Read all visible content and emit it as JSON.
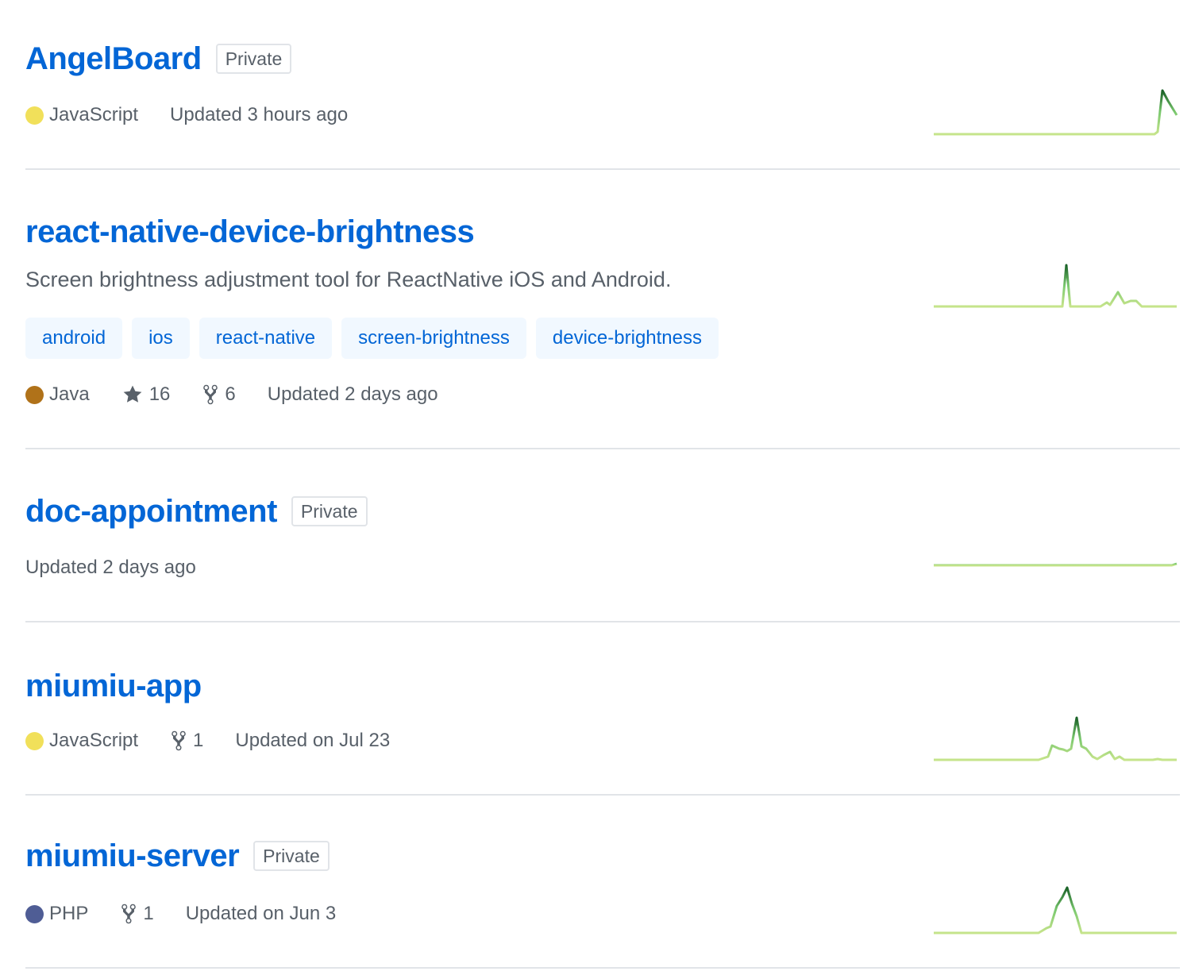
{
  "colors": {
    "link": "#0366d6",
    "muted": "#586069",
    "topic_bg": "#f1f8ff",
    "divider": "#e1e4e8",
    "spark_light": "#c6e48b",
    "spark_dark": "#196127"
  },
  "repos": [
    {
      "name": "AngelBoard",
      "badge": "Private",
      "language": "JavaScript",
      "language_color": "#f1e05a",
      "updated": "Updated 3 hours ago"
    },
    {
      "name": "react-native-device-brightness",
      "description": "Screen brightness adjustment tool for ReactNative iOS and Android.",
      "topics": [
        "android",
        "ios",
        "react-native",
        "screen-brightness",
        "device-brightness"
      ],
      "language": "Java",
      "language_color": "#b07219",
      "stars": "16",
      "forks": "6",
      "updated": "Updated 2 days ago"
    },
    {
      "name": "doc-appointment",
      "badge": "Private",
      "updated": "Updated 2 days ago"
    },
    {
      "name": "miumiu-app",
      "language": "JavaScript",
      "language_color": "#f1e05a",
      "forks": "1",
      "updated": "Updated on Jul 23"
    },
    {
      "name": "miumiu-server",
      "badge": "Private",
      "language": "PHP",
      "language_color": "#4F5D95",
      "forks": "1",
      "updated": "Updated on Jun 3"
    }
  ]
}
